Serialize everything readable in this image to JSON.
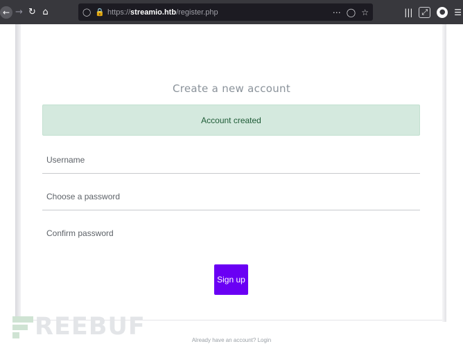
{
  "browser": {
    "url_scheme": "https://",
    "url_host": "streamio.htb",
    "url_path": "/register.php",
    "icons": [
      "back-icon",
      "forward-icon",
      "reload-icon",
      "home-icon",
      "shield-icon",
      "lock-icon",
      "more-icon",
      "pocket-icon",
      "bookmark-star-icon",
      "library-icon",
      "screenshot-icon",
      "chat-icon",
      "menu-icon"
    ]
  },
  "form": {
    "title": "Create a new account",
    "alert": "Account created",
    "username_placeholder": "Username",
    "password_placeholder": "Choose a password",
    "confirm_placeholder": "Confirm password",
    "signup_label": "Sign up",
    "login_note": "Already have an account? Login"
  },
  "watermark": {
    "text": "REEBUF"
  },
  "colors": {
    "accent": "#6a00f4",
    "alert_bg": "#d4e9de",
    "alert_text": "#1d5a35",
    "toolbar": "#38383d"
  }
}
